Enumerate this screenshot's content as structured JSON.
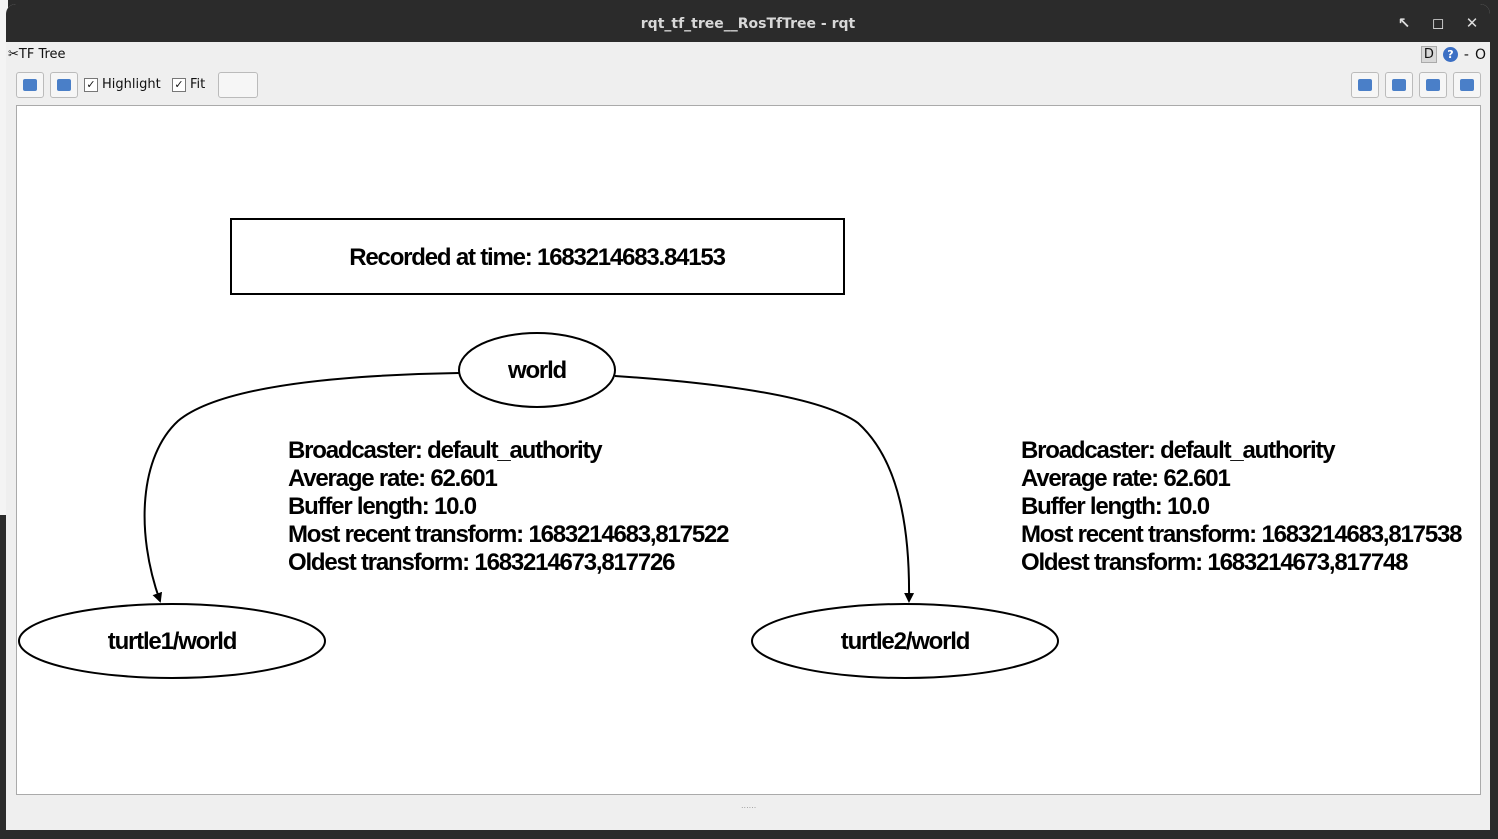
{
  "window": {
    "title": "rqt_tf_tree__RosTfTree - rqt"
  },
  "plugin": {
    "title": "TF Tree",
    "d_label": "D",
    "help_label": "?",
    "dash": "-",
    "close": "O"
  },
  "toolbar": {
    "highlight_label": "Highlight",
    "highlight_checked": true,
    "fit_label": "Fit",
    "fit_checked": true,
    "check": "✓"
  },
  "graph": {
    "recorded": "Recorded at time: 1683214683.84153",
    "nodes": {
      "world": "world",
      "turtle1": "turtle1/world",
      "turtle2": "turtle2/world"
    },
    "edge1": [
      "Broadcaster: default_authority",
      "Average rate: 62.601",
      "Buffer length: 10.0",
      "Most recent transform: 1683214683,817522",
      "Oldest transform: 1683214673,817726"
    ],
    "edge2": [
      "Broadcaster: default_authority",
      "Average rate: 62.601",
      "Buffer length: 10.0",
      "Most recent transform: 1683214683,817538",
      "Oldest transform: 1683214673,817748"
    ]
  }
}
